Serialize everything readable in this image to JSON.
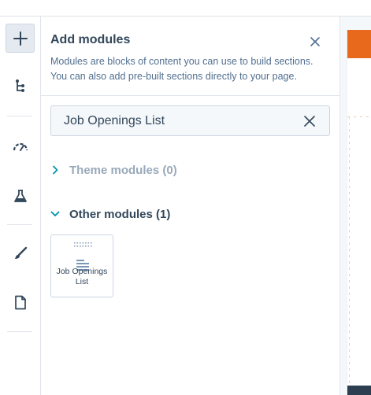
{
  "panel": {
    "title": "Add modules",
    "description": "Modules are blocks of content you can use to build sections. You can also add pre-built sections directly to your page.",
    "close_icon": "close-icon"
  },
  "search": {
    "value": "Job Openings List",
    "placeholder": "Search modules",
    "clear_icon": "close-icon"
  },
  "sections": [
    {
      "label": "Theme modules (0)",
      "expanded": false,
      "icon": "chevron-right-icon"
    },
    {
      "label": "Other modules (1)",
      "expanded": true,
      "icon": "chevron-down-icon"
    }
  ],
  "modules": [
    {
      "label": "Job Openings List",
      "icon": "list-module-icon"
    }
  ],
  "rail": [
    {
      "name": "add",
      "icon": "plus-icon",
      "active": true
    },
    {
      "name": "layers",
      "icon": "tree-structure-icon",
      "active": false
    },
    {
      "name": "optimize",
      "icon": "gauge-icon",
      "active": false
    },
    {
      "name": "test",
      "icon": "flask-icon",
      "active": false
    },
    {
      "name": "design",
      "icon": "brush-icon",
      "active": false
    },
    {
      "name": "page-settings",
      "icon": "page-icon",
      "active": false
    }
  ],
  "colors": {
    "accent": "#e8691c",
    "text": "#33475b",
    "muted": "#99a9bb",
    "chevron": "#0091ae",
    "border": "#cbd6e2"
  }
}
